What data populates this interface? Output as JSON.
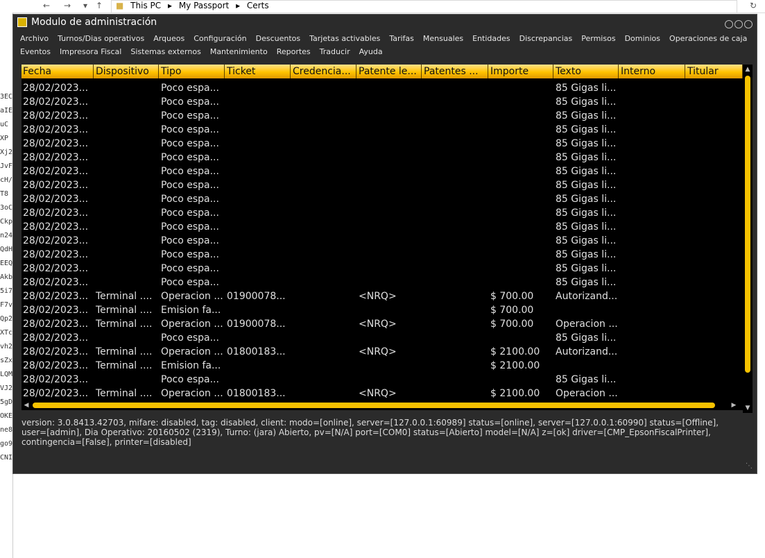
{
  "explorer": {
    "back_icon": "arrow-left",
    "forward_icon": "arrow-right",
    "up_icon": "arrow-up",
    "breadcrumb": [
      "This PC",
      "My Passport",
      "Certs"
    ]
  },
  "left_strip": [
    "3EC",
    "aIE",
    "uC",
    "XP",
    "Xj2",
    "JvF",
    "cH/",
    "T8",
    "3oC",
    "Ckp",
    "n24",
    "QdH",
    "EEQ",
    "Akb",
    "5i7",
    "F7v",
    "Qp2",
    "XTc",
    "vh2",
    "sZx",
    "LQM",
    "VJ2",
    "5gD",
    "OKE",
    "ne8",
    "go9",
    "CNI"
  ],
  "window": {
    "title": "Modulo de administración",
    "menu_row1": [
      "Archivo",
      "Turnos/Dias operativos",
      "Arqueos",
      "Configuración",
      "Descuentos",
      "Tarjetas activables",
      "Tarifas",
      "Mensuales",
      "Entidades",
      "Discrepancias",
      "Permisos",
      "Dominios",
      "Operaciones de caja"
    ],
    "menu_row2": [
      "Eventos",
      "Impresora Fiscal",
      "Sistemas externos",
      "Mantenimiento",
      "Reportes",
      "Traducir",
      "Ayuda"
    ]
  },
  "grid": {
    "columns": [
      "Fecha",
      "Dispositivo",
      "Tipo",
      "Ticket",
      "Credencia...",
      "Patente le...",
      "Patentes ...",
      "Importe",
      "Texto",
      "Interno",
      "Titular"
    ],
    "rows": [
      [
        "28/02/2023...",
        "",
        "Poco espa...",
        "",
        "",
        "",
        "",
        "",
        "85 Gigas li...",
        "",
        ""
      ],
      [
        "28/02/2023...",
        "",
        "Poco espa...",
        "",
        "",
        "",
        "",
        "",
        "85 Gigas li...",
        "",
        ""
      ],
      [
        "28/02/2023...",
        "",
        "Poco espa...",
        "",
        "",
        "",
        "",
        "",
        "85 Gigas li...",
        "",
        ""
      ],
      [
        "28/02/2023...",
        "",
        "Poco espa...",
        "",
        "",
        "",
        "",
        "",
        "85 Gigas li...",
        "",
        ""
      ],
      [
        "28/02/2023...",
        "",
        "Poco espa...",
        "",
        "",
        "",
        "",
        "",
        "85 Gigas li...",
        "",
        ""
      ],
      [
        "28/02/2023...",
        "",
        "Poco espa...",
        "",
        "",
        "",
        "",
        "",
        "85 Gigas li...",
        "",
        ""
      ],
      [
        "28/02/2023...",
        "",
        "Poco espa...",
        "",
        "",
        "",
        "",
        "",
        "85 Gigas li...",
        "",
        ""
      ],
      [
        "28/02/2023...",
        "",
        "Poco espa...",
        "",
        "",
        "",
        "",
        "",
        "85 Gigas li...",
        "",
        ""
      ],
      [
        "28/02/2023...",
        "",
        "Poco espa...",
        "",
        "",
        "",
        "",
        "",
        "85 Gigas li...",
        "",
        ""
      ],
      [
        "28/02/2023...",
        "",
        "Poco espa...",
        "",
        "",
        "",
        "",
        "",
        "85 Gigas li...",
        "",
        ""
      ],
      [
        "28/02/2023...",
        "",
        "Poco espa...",
        "",
        "",
        "",
        "",
        "",
        "85 Gigas li...",
        "",
        ""
      ],
      [
        "28/02/2023...",
        "",
        "Poco espa...",
        "",
        "",
        "",
        "",
        "",
        "85 Gigas li...",
        "",
        ""
      ],
      [
        "28/02/2023...",
        "",
        "Poco espa...",
        "",
        "",
        "",
        "",
        "",
        "85 Gigas li...",
        "",
        ""
      ],
      [
        "28/02/2023...",
        "",
        "Poco espa...",
        "",
        "",
        "",
        "",
        "",
        "85 Gigas li...",
        "",
        ""
      ],
      [
        "28/02/2023...",
        "",
        "Poco espa...",
        "",
        "",
        "",
        "",
        "",
        "85 Gigas li...",
        "",
        ""
      ],
      [
        "28/02/2023...",
        "Terminal ....",
        "Operacion ...",
        "01900078...",
        "",
        "<NRQ>",
        "",
        "$ 700.00",
        "Autorizand...",
        "",
        ""
      ],
      [
        "28/02/2023...",
        "Terminal ....",
        "Emision fa...",
        "",
        "",
        "",
        "",
        "$ 700.00",
        "",
        "",
        ""
      ],
      [
        "28/02/2023...",
        "Terminal ....",
        "Operacion ...",
        "01900078...",
        "",
        "<NRQ>",
        "",
        "$ 700.00",
        "Operacion ...",
        "",
        ""
      ],
      [
        "28/02/2023...",
        "",
        "Poco espa...",
        "",
        "",
        "",
        "",
        "",
        "85 Gigas li...",
        "",
        ""
      ],
      [
        "28/02/2023...",
        "Terminal ....",
        "Operacion ...",
        "01800183...",
        "",
        "<NRQ>",
        "",
        "$ 2100.00",
        "Autorizand...",
        "",
        ""
      ],
      [
        "28/02/2023...",
        "Terminal ....",
        "Emision fa...",
        "",
        "",
        "",
        "",
        "$ 2100.00",
        "",
        "",
        ""
      ],
      [
        "28/02/2023...",
        "",
        "Poco espa...",
        "",
        "",
        "",
        "",
        "",
        "85 Gigas li...",
        "",
        ""
      ],
      [
        "28/02/2023...",
        "Terminal ....",
        "Operacion ...",
        "01800183...",
        "",
        "<NRQ>",
        "",
        "$ 2100.00",
        "Operacion ...",
        "",
        ""
      ]
    ]
  },
  "status": {
    "line1": "version: 3.0.8413.42703, mifare: disabled, tag: disabled, client: modo=[online], server=[127.0.0.1:60989] status=[online], server=[127.0.0.1:60990] status=[Offline],",
    "line2": "user=[admin], Dia Operativo: 20160502 (2319), Turno: (jara) Abierto, pv=[N/A] port=[COM0] status=[Abierto] model=[N/A] z=[ok] driver=[CMP_EpsonFiscalPrinter],",
    "line3": "contingencia=[False], printer=[disabled]"
  },
  "colors": {
    "accent": "#ffc200",
    "grid_bg": "#000000",
    "window_bg": "#2b2b2b"
  }
}
